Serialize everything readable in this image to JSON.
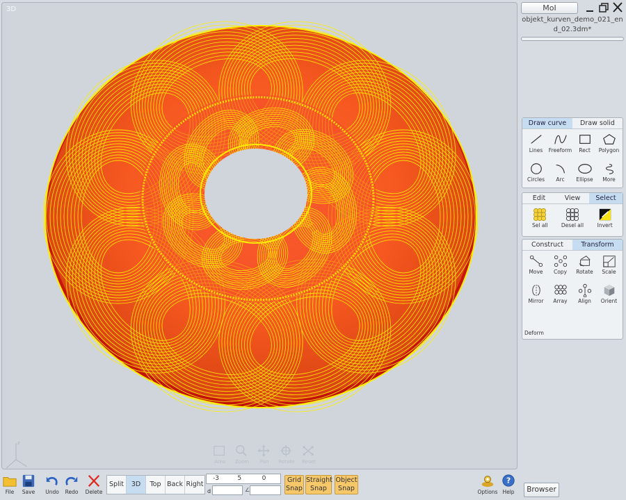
{
  "viewport": {
    "label": "3D"
  },
  "nav_tools": [
    {
      "label": "Area",
      "icon": "area-zoom-icon"
    },
    {
      "label": "Zoom",
      "icon": "magnifier-icon"
    },
    {
      "label": "Pan",
      "icon": "pan-arrows-icon"
    },
    {
      "label": "Rotate",
      "icon": "rotate-icon"
    },
    {
      "label": "Reset",
      "icon": "reset-view-icon"
    }
  ],
  "app": {
    "title_button": "MoI",
    "file_name": "objekt_kurven_demo_021_end_02.3dm*"
  },
  "draw_panel": {
    "tabs": [
      {
        "label": "Draw curve",
        "active": true
      },
      {
        "label": "Draw solid",
        "active": false
      }
    ],
    "tools": [
      {
        "label": "Lines",
        "icon": "line-icon"
      },
      {
        "label": "Freeform",
        "icon": "freeform-curve-icon"
      },
      {
        "label": "Rect",
        "icon": "rectangle-icon"
      },
      {
        "label": "Polygon",
        "icon": "polygon-icon"
      },
      {
        "label": "Circles",
        "icon": "circle-icon"
      },
      {
        "label": "Arc",
        "icon": "arc-icon"
      },
      {
        "label": "Ellipse",
        "icon": "ellipse-icon"
      },
      {
        "label": "More",
        "icon": "spiral-icon"
      }
    ]
  },
  "edit_panel": {
    "tabs": [
      {
        "label": "Edit",
        "active": false
      },
      {
        "label": "View",
        "active": false
      },
      {
        "label": "Select",
        "active": true
      }
    ],
    "tools": [
      {
        "label": "Sel all",
        "icon": "select-all-icon"
      },
      {
        "label": "Desel all",
        "icon": "deselect-all-icon"
      },
      {
        "label": "Invert",
        "icon": "invert-selection-icon"
      }
    ]
  },
  "construct_panel": {
    "tabs": [
      {
        "label": "Construct",
        "active": false
      },
      {
        "label": "Transform",
        "active": true
      }
    ],
    "tools": [
      {
        "label": "Move",
        "icon": "move-icon"
      },
      {
        "label": "Copy",
        "icon": "copy-icon"
      },
      {
        "label": "Rotate",
        "icon": "rotate-object-icon"
      },
      {
        "label": "Scale",
        "icon": "scale-icon"
      },
      {
        "label": "Mirror",
        "icon": "mirror-icon"
      },
      {
        "label": "Array",
        "icon": "array-icon"
      },
      {
        "label": "Align",
        "icon": "align-icon"
      },
      {
        "label": "Orient",
        "icon": "orient-icon"
      }
    ],
    "section_label": "Deform"
  },
  "bottom_tools": [
    {
      "label": "File",
      "icon": "folder-icon"
    },
    {
      "label": "Save",
      "icon": "save-disk-icon"
    },
    {
      "label": "Undo",
      "icon": "undo-arrow-icon"
    },
    {
      "label": "Redo",
      "icon": "redo-arrow-icon"
    },
    {
      "label": "Delete",
      "icon": "delete-x-icon"
    }
  ],
  "view_buttons": [
    {
      "label": "Split",
      "active": false
    },
    {
      "label": "3D",
      "active": true
    },
    {
      "label": "Top",
      "active": false
    },
    {
      "label": "Back",
      "active": false
    },
    {
      "label": "Right",
      "active": false
    }
  ],
  "coordinates": {
    "x": "-3",
    "y": "5",
    "z": "0",
    "distance_label": "d",
    "angle_label": "∠"
  },
  "snaps": [
    {
      "line1": "Grid",
      "line2": "Snap"
    },
    {
      "line1": "Straight",
      "line2": "Snap"
    },
    {
      "line1": "Object",
      "line2": "Snap"
    }
  ],
  "right_tools": [
    {
      "label": "Options",
      "icon": "options-gear-icon"
    },
    {
      "label": "Help",
      "icon": "help-question-icon"
    }
  ],
  "browser_button": "Browser",
  "colors": {
    "torus": "#ee2d15",
    "wire": "#ffee00",
    "active_tab": "#c5dcf1",
    "snap": "#f6c86a"
  }
}
